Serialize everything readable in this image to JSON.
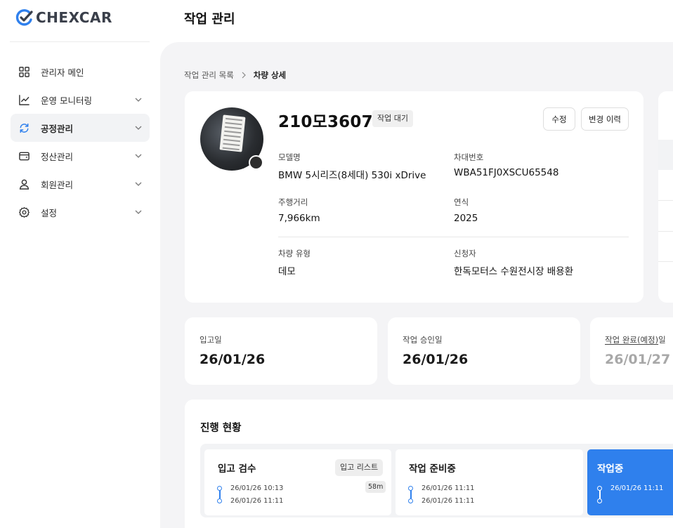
{
  "brand": {
    "name": "CHEXCAR"
  },
  "header": {
    "title": "작업 관리"
  },
  "sidebar": {
    "items": [
      {
        "label": "관리자 메인",
        "icon": "grid-icon",
        "expandable": false,
        "active": false
      },
      {
        "label": "운영 모니터링",
        "icon": "chart-line-icon",
        "expandable": true,
        "active": false
      },
      {
        "label": "공정관리",
        "icon": "refresh-icon",
        "expandable": true,
        "active": true
      },
      {
        "label": "정산관리",
        "icon": "wallet-icon",
        "expandable": true,
        "active": false
      },
      {
        "label": "회원관리",
        "icon": "user-icon",
        "expandable": true,
        "active": false
      },
      {
        "label": "설정",
        "icon": "gear-icon",
        "expandable": true,
        "active": false
      }
    ]
  },
  "breadcrumb": {
    "parent": "작업 관리 목록",
    "current": "차량 상세"
  },
  "vehicle": {
    "plate": "210모3607",
    "status": "작업 대기",
    "edit_label": "수정",
    "history_label": "변경 이력",
    "fields": {
      "model_label": "모델명",
      "model_value": "BMW 5시리즈(8세대) 530i xDrive",
      "vin_label": "차대번호",
      "vin_value": "WBA51FJ0XSCU65548",
      "mileage_label": "주행거리",
      "mileage_value": "7,966km",
      "year_label": "연식",
      "year_value": "2025",
      "type_label": "차량 유형",
      "type_value": "데모",
      "applicant_label": "신청자",
      "applicant_value": "한독모터스 수원전시장 배용환"
    }
  },
  "dates": {
    "received_label": "입고일",
    "received_value": "26/01/26",
    "approved_label": "작업 승인일",
    "approved_value": "26/01/26",
    "complete_label_prefix": "작업 완료(예정)",
    "complete_label_suffix": "일",
    "complete_value": "26/01/27"
  },
  "progress": {
    "title": "진행 현황",
    "steps": [
      {
        "title": "입고 검수",
        "button": "입고 리스트",
        "duration": "58m",
        "times": [
          "26/01/26 10:13",
          "26/01/26 11:11"
        ],
        "active": false
      },
      {
        "title": "작업 준비중",
        "times": [
          "26/01/26 11:11",
          "26/01/26 11:11"
        ],
        "active": false
      },
      {
        "title": "작업중",
        "times": [
          "26/01/26 11:11"
        ],
        "active": true
      }
    ]
  },
  "colors": {
    "accent": "#2f80ed",
    "background": "#f4f4f6",
    "logo_check": "#2f80ed"
  }
}
